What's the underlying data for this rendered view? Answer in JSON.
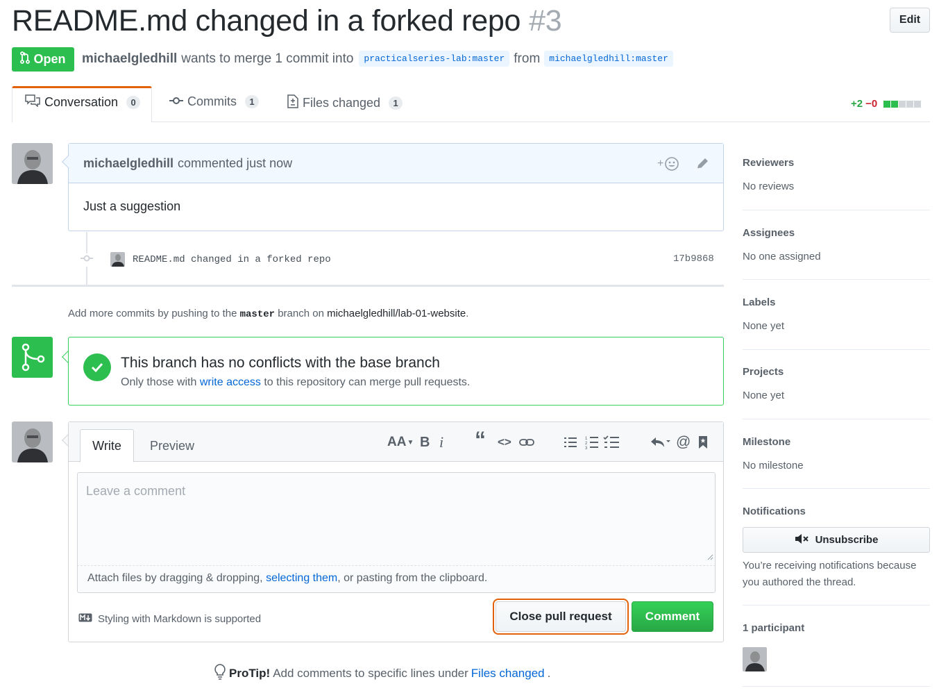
{
  "pr": {
    "title": "README.md changed in a forked repo",
    "number": "#3",
    "edit_label": "Edit",
    "state_label": "Open",
    "author": "michaelgledhill",
    "merge_text": "wants to merge 1 commit into",
    "base_ref": "practicalseries-lab:master",
    "from_text": "from",
    "head_ref": "michaelgledhill:master"
  },
  "tabs": [
    {
      "label": "Conversation",
      "count": "0"
    },
    {
      "label": "Commits",
      "count": "1"
    },
    {
      "label": "Files changed",
      "count": "1"
    }
  ],
  "diffstat": {
    "additions": "+2",
    "deletions": "−0"
  },
  "comment": {
    "author": "michaelgledhill",
    "action": "commented just now",
    "body": "Just a suggestion"
  },
  "commit": {
    "message": "README.md changed in a forked repo",
    "sha": "17b9868"
  },
  "push_note": {
    "prefix": "Add more commits by pushing to the",
    "branch": "master",
    "middle": "branch on",
    "repo": "michaelgledhill/lab-01-website",
    "suffix": "."
  },
  "merge": {
    "title": "This branch has no conflicts with the base branch",
    "sub_prefix": "Only those with",
    "sub_link": "write access",
    "sub_suffix": "to this repository can merge pull requests."
  },
  "form": {
    "tab_write": "Write",
    "tab_preview": "Preview",
    "placeholder": "Leave a comment",
    "attach_prefix": "Attach files by dragging & dropping,",
    "attach_link": "selecting them",
    "attach_suffix": ", or pasting from the clipboard.",
    "markdown_note": "Styling with Markdown is supported",
    "close_label": "Close pull request",
    "comment_label": "Comment",
    "toolbar": {
      "header": "AA",
      "bold": "B",
      "italic": "i",
      "quote": "“",
      "code": "<>"
    }
  },
  "protip": {
    "label": "ProTip!",
    "text": "Add comments to specific lines under",
    "link": "Files changed",
    "suffix": "."
  },
  "sidebar": {
    "reviewers": {
      "heading": "Reviewers",
      "value": "No reviews"
    },
    "assignees": {
      "heading": "Assignees",
      "value": "No one assigned"
    },
    "labels": {
      "heading": "Labels",
      "value": "None yet"
    },
    "projects": {
      "heading": "Projects",
      "value": "None yet"
    },
    "milestone": {
      "heading": "Milestone",
      "value": "No milestone"
    },
    "notifications": {
      "heading": "Notifications",
      "button": "Unsubscribe",
      "text": "You’re receiving notifications because you authored the thread."
    },
    "participants": {
      "heading": "1 participant"
    }
  },
  "colors": {
    "open_green": "#2cbe4e",
    "link_blue": "#0366d6",
    "focus_orange": "#e36209",
    "add_green": "#28a745",
    "del_red": "#cb2431"
  }
}
